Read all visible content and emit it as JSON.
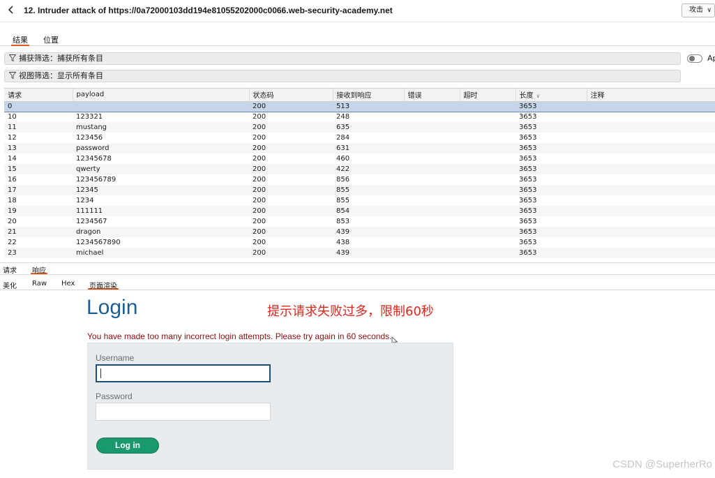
{
  "window": {
    "title": "12. Intruder attack of https://0a72000103dd194e81055202000c0066.web-security-academy.net",
    "attack_menu": "攻击"
  },
  "top_tabs": [
    {
      "label": "结果",
      "active": true
    },
    {
      "label": "位置",
      "active": false
    }
  ],
  "filters": {
    "capture": "捕获筛选：捕获所有条目",
    "view": "视图筛选：显示所有条目",
    "toggle_label": "Ap"
  },
  "table": {
    "columns": [
      "请求",
      "payload",
      "状态码",
      "接收到响应",
      "错误",
      "超时",
      "长度",
      "注释"
    ],
    "sorted_column": "长度",
    "selected_row": 0,
    "rows": [
      [
        "0",
        "",
        "200",
        "513",
        "",
        "",
        "3653",
        ""
      ],
      [
        "10",
        "123321",
        "200",
        "248",
        "",
        "",
        "3653",
        ""
      ],
      [
        "11",
        "mustang",
        "200",
        "635",
        "",
        "",
        "3653",
        ""
      ],
      [
        "12",
        "123456",
        "200",
        "284",
        "",
        "",
        "3653",
        ""
      ],
      [
        "13",
        "password",
        "200",
        "631",
        "",
        "",
        "3653",
        ""
      ],
      [
        "14",
        "12345678",
        "200",
        "460",
        "",
        "",
        "3653",
        ""
      ],
      [
        "15",
        "qwerty",
        "200",
        "422",
        "",
        "",
        "3653",
        ""
      ],
      [
        "16",
        "123456789",
        "200",
        "856",
        "",
        "",
        "3653",
        ""
      ],
      [
        "17",
        "12345",
        "200",
        "855",
        "",
        "",
        "3653",
        ""
      ],
      [
        "18",
        "1234",
        "200",
        "855",
        "",
        "",
        "3653",
        ""
      ],
      [
        "19",
        "111111",
        "200",
        "854",
        "",
        "",
        "3653",
        ""
      ],
      [
        "20",
        "1234567",
        "200",
        "853",
        "",
        "",
        "3653",
        ""
      ],
      [
        "21",
        "dragon",
        "200",
        "439",
        "",
        "",
        "3653",
        ""
      ],
      [
        "22",
        "1234567890",
        "200",
        "438",
        "",
        "",
        "3653",
        ""
      ],
      [
        "23",
        "michael",
        "200",
        "439",
        "",
        "",
        "3653",
        ""
      ]
    ]
  },
  "req_resp_tabs": [
    {
      "label": "请求",
      "active": false
    },
    {
      "label": "响应",
      "active": true
    }
  ],
  "view_tabs": [
    {
      "label": "美化",
      "active": false
    },
    {
      "label": "Raw",
      "active": false
    },
    {
      "label": "Hex",
      "active": false
    },
    {
      "label": "页面渲染",
      "active": true
    }
  ],
  "render": {
    "heading": "Login",
    "annotation": "提示请求失败过多，限制60秒",
    "error": "You have made too many incorrect login attempts. Please try again in 60 seconds.",
    "username_label": "Username",
    "username_value": "",
    "password_label": "Password",
    "password_value": "",
    "login_button": "Log in"
  },
  "watermark": "CSDN @SuperherRo",
  "colors": {
    "accent": "#e05a1c",
    "heading": "#1d5f93",
    "annotation": "#e0261a",
    "error": "#8b0f0f",
    "login_button": "#1a9a6c",
    "selected_row": "#c5d5ea"
  }
}
